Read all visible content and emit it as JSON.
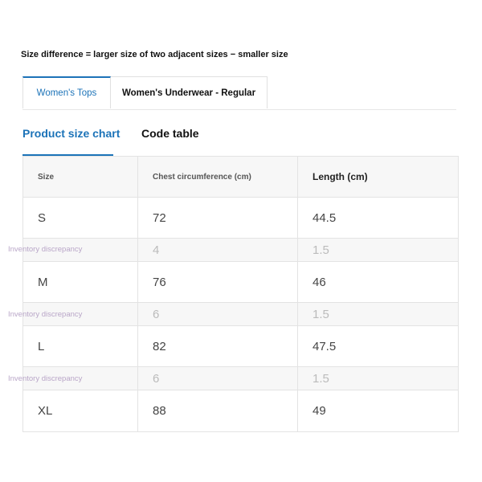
{
  "note": "Size difference = larger size of two adjacent sizes − smaller size",
  "category_tabs": [
    {
      "label": "Women's Tops",
      "active": true
    },
    {
      "label": "Women's Underwear - Regular",
      "active": false
    }
  ],
  "view_tabs": [
    {
      "label": "Product size chart",
      "active": true
    },
    {
      "label": "Code table",
      "active": false
    }
  ],
  "table": {
    "headers": [
      "Size",
      "Chest circumference (cm)",
      "Length (cm)"
    ],
    "rows": [
      {
        "type": "size",
        "cells": [
          "S",
          "72",
          "44.5"
        ]
      },
      {
        "type": "diff",
        "cells": [
          "",
          "4",
          "1.5"
        ]
      },
      {
        "type": "size",
        "cells": [
          "M",
          "76",
          "46"
        ]
      },
      {
        "type": "diff",
        "cells": [
          "",
          "6",
          "1.5"
        ]
      },
      {
        "type": "size",
        "cells": [
          "L",
          "82",
          "47.5"
        ]
      },
      {
        "type": "diff",
        "cells": [
          "",
          "6",
          "1.5"
        ]
      },
      {
        "type": "size",
        "cells": [
          "XL",
          "88",
          "49"
        ]
      }
    ]
  },
  "watermarks": [
    "Inventory discrepancy",
    "Inventory discrepancy",
    "Inventory discrepancy"
  ],
  "colors": {
    "accent": "#1c73b8",
    "border": "#e3e3e3",
    "header_bg": "#f7f7f7",
    "watermark": "#b9a6c8"
  }
}
